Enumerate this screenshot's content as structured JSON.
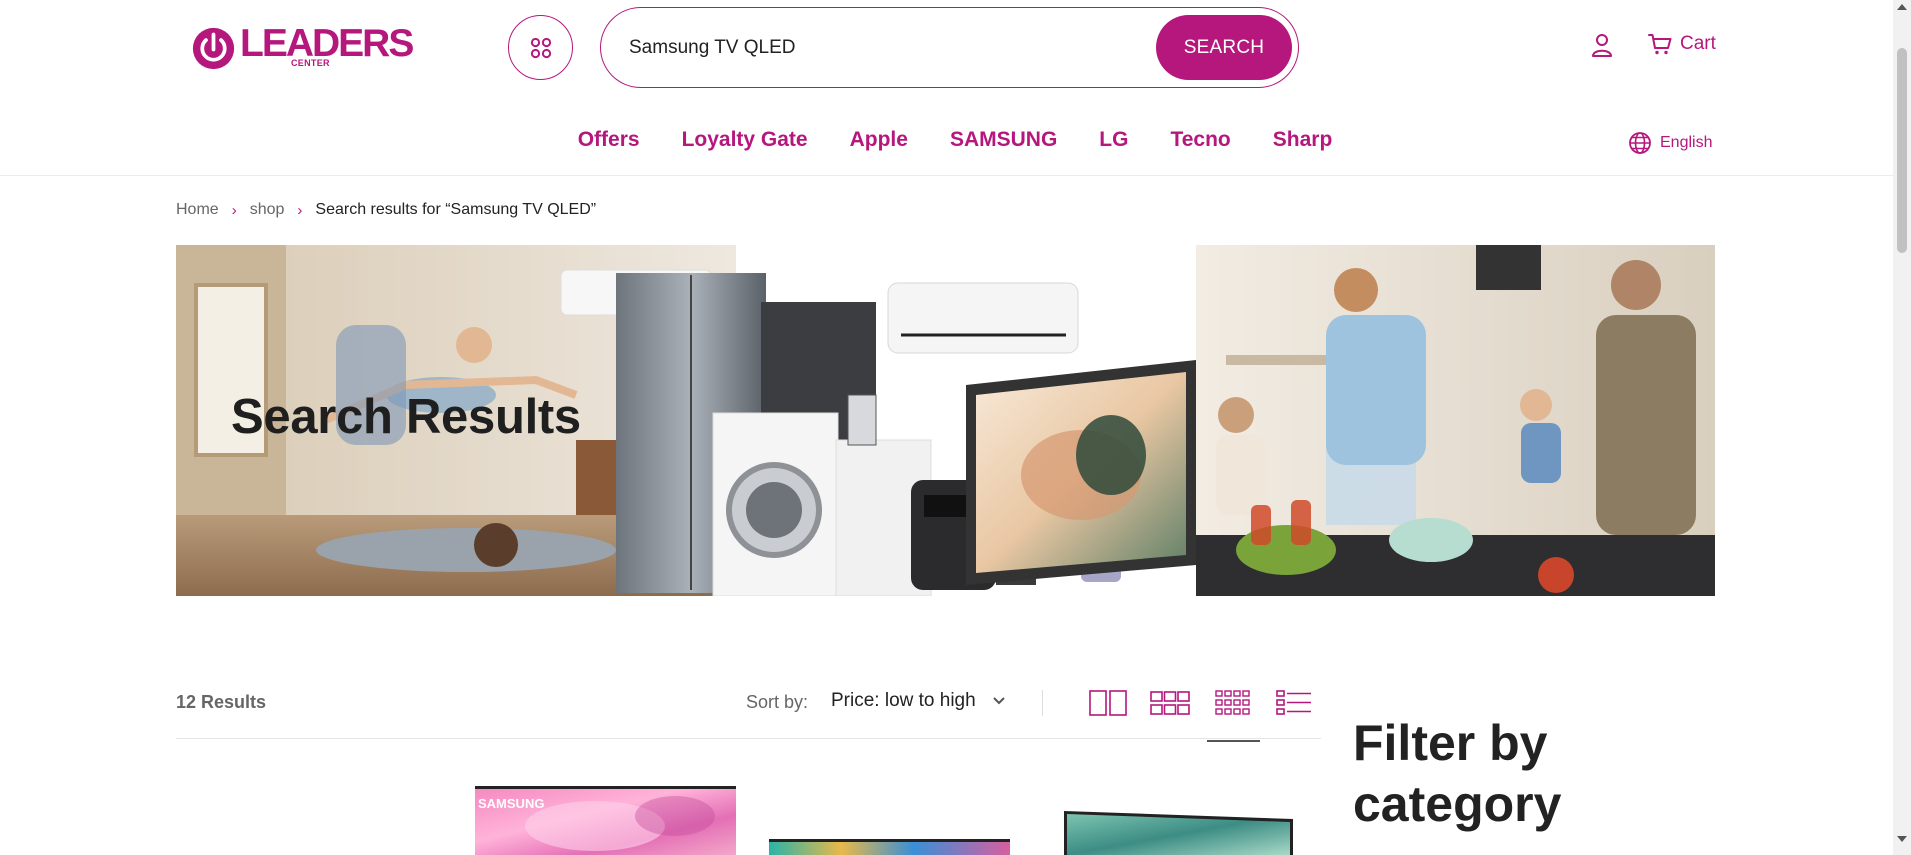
{
  "brand": {
    "logo_text": "LEADERS",
    "logo_subtext": "CENTER",
    "accent_color": "#b5177d"
  },
  "header": {
    "categories_icon": "grid-dots-icon",
    "search": {
      "value": "Samsung TV QLED",
      "button_label": "SEARCH"
    },
    "account_icon": "user-icon",
    "cart_icon": "cart-icon",
    "cart_label": "Cart"
  },
  "nav": {
    "items": [
      {
        "label": "Offers"
      },
      {
        "label": "Loyalty Gate"
      },
      {
        "label": "Apple"
      },
      {
        "label": "SAMSUNG"
      },
      {
        "label": "LG"
      },
      {
        "label": "Tecno"
      },
      {
        "label": "Sharp"
      }
    ],
    "language_icon": "globe-icon",
    "language_label": "English"
  },
  "breadcrumb": {
    "items": [
      {
        "label": "Home"
      },
      {
        "label": "shop"
      }
    ],
    "current": "Search results for “Samsung TV QLED”"
  },
  "hero": {
    "title": "Search Results"
  },
  "toolbar": {
    "results_count": "12 Results",
    "sort_label": "Sort by:",
    "sort_value": "Price: low to high",
    "view_options": [
      {
        "icon": "grid-2-columns-icon",
        "active": false
      },
      {
        "icon": "grid-3-columns-icon",
        "active": false
      },
      {
        "icon": "grid-4-columns-icon",
        "active": true
      },
      {
        "icon": "list-view-icon",
        "active": false
      }
    ]
  },
  "sidebar": {
    "filter_title": "Filter by category"
  },
  "products": {
    "visible_partial": 4
  }
}
